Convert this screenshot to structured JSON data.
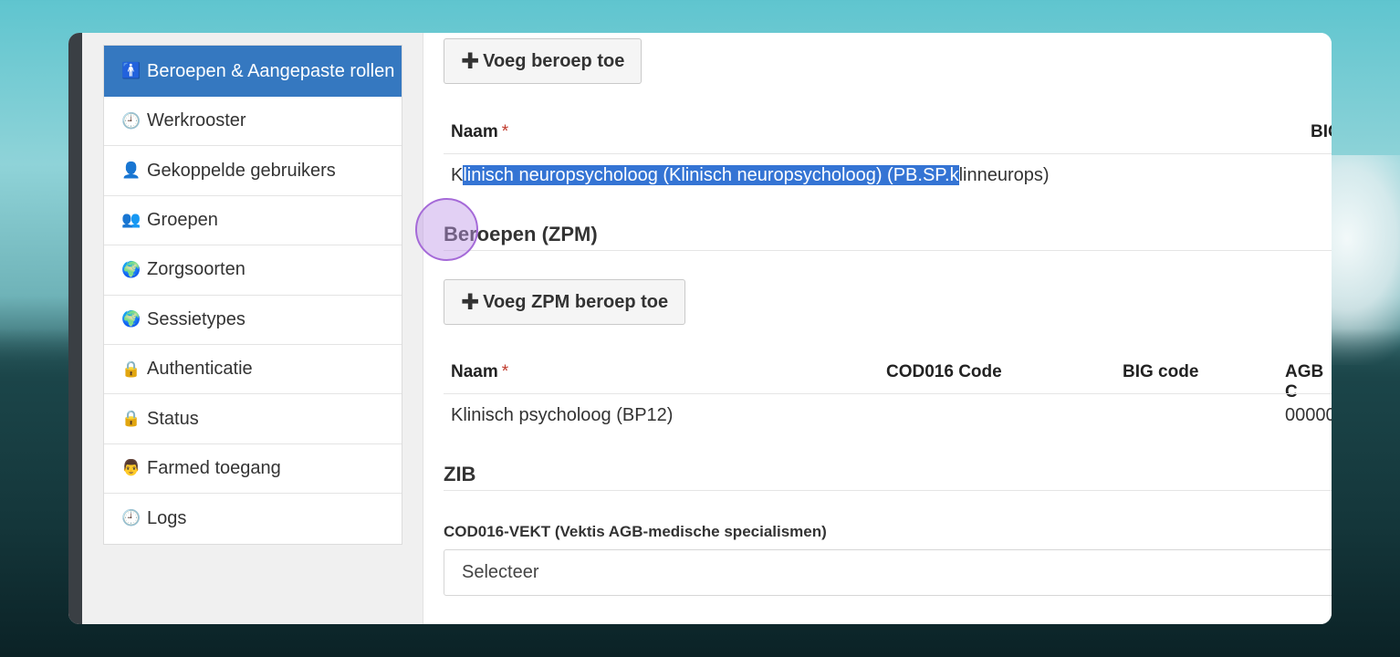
{
  "sidebar": {
    "items": [
      {
        "label": "Beroepen & Aangepaste rollen",
        "icon": "person-icon",
        "glyph": "🚹",
        "active": true
      },
      {
        "label": "Werkrooster",
        "icon": "clock-icon",
        "glyph": "🕘",
        "active": false
      },
      {
        "label": "Gekoppelde gebruikers",
        "icon": "user-icon",
        "glyph": "👤",
        "active": false
      },
      {
        "label": "Groepen",
        "icon": "users-icon",
        "glyph": "👥",
        "active": false
      },
      {
        "label": "Zorgsoorten",
        "icon": "globe-icon",
        "glyph": "🌍",
        "active": false
      },
      {
        "label": "Sessietypes",
        "icon": "globe-icon",
        "glyph": "🌍",
        "active": false
      },
      {
        "label": "Authenticatie",
        "icon": "lock-icon",
        "glyph": "🔒",
        "active": false
      },
      {
        "label": "Status",
        "icon": "lock-icon",
        "glyph": "🔒",
        "active": false
      },
      {
        "label": "Farmed toegang",
        "icon": "user-doctor-icon",
        "glyph": "👨",
        "active": false
      },
      {
        "label": "Logs",
        "icon": "clock-icon",
        "glyph": "🕘",
        "active": false
      }
    ]
  },
  "beroep": {
    "add_button": "Voeg beroep toe",
    "headers": {
      "naam": "Naam",
      "required_mark": "*",
      "big": "BIG"
    },
    "row": {
      "prefix": "K",
      "highlighted": "linisch neuropsycholoog (Klinisch neuropsycholoog) (PB.SP.k",
      "suffix": "linneurops)"
    }
  },
  "zpm": {
    "title": "Beroepen (ZPM)",
    "add_button": "Voeg ZPM beroep toe",
    "headers": {
      "naam": "Naam",
      "required_mark": "*",
      "cod016": "COD016 Code",
      "big": "BIG code",
      "agb": "AGB C"
    },
    "row": {
      "naam": "Klinisch psycholoog (BP12)",
      "agb": "00000"
    }
  },
  "zib": {
    "title": "ZIB",
    "field_label": "COD016-VEKT (Vektis AGB-medische specialismen)",
    "select_value": "Selecteer"
  },
  "plus_glyph": "✚",
  "colors": {
    "active_item": "#3578c0",
    "highlight": "#3474d4",
    "required": "#c0392b"
  }
}
